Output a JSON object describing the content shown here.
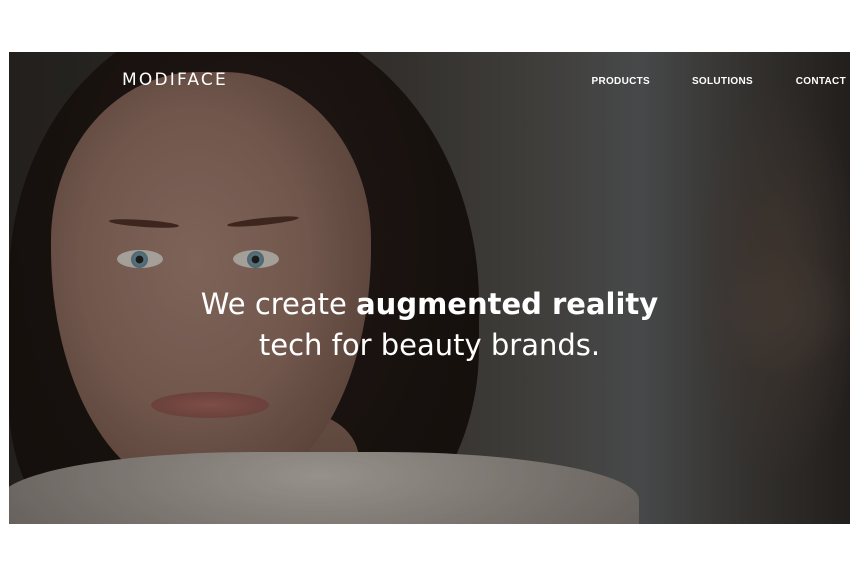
{
  "header": {
    "logo": "MODIFACE",
    "nav": [
      {
        "label": "PRODUCTS"
      },
      {
        "label": "SOLUTIONS"
      },
      {
        "label": "CONTACT"
      }
    ]
  },
  "hero": {
    "headline_part1": "We create ",
    "headline_bold": "augmented reality",
    "headline_line2": "tech for beauty brands."
  },
  "colors": {
    "text": "#ffffff",
    "page_background": "#ffffff"
  }
}
